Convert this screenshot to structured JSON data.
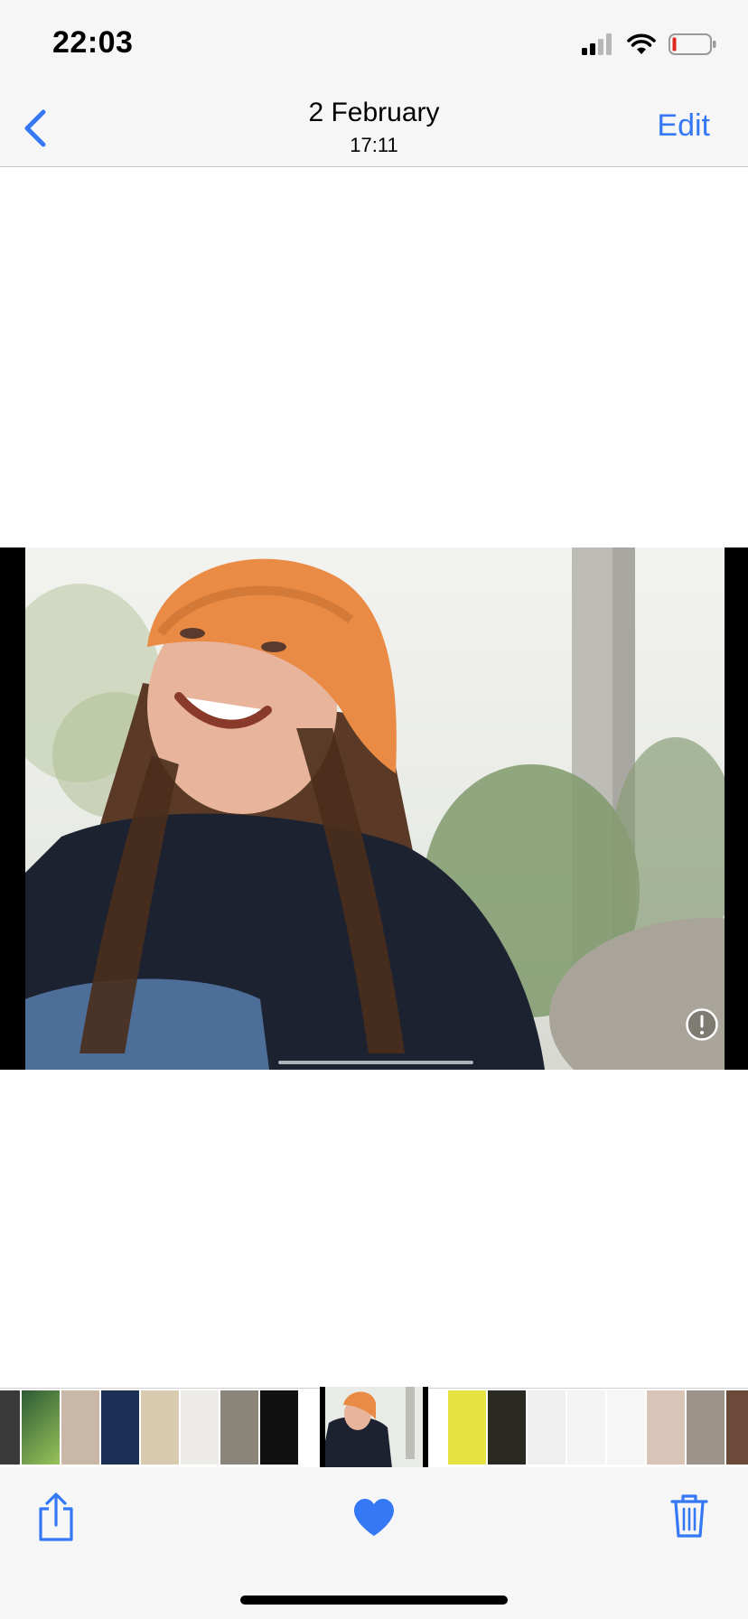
{
  "status_bar": {
    "time": "22:03",
    "icons": [
      "cellular-signal-icon",
      "wifi-icon",
      "battery-low-icon"
    ]
  },
  "nav": {
    "back_icon": "chevron-left-icon",
    "title": "2 February",
    "subtitle": "17:11",
    "edit_label": "Edit"
  },
  "photo": {
    "alt": "selfie-photo",
    "info_icon": "exclamation-circle-icon"
  },
  "toolbar": {
    "share_icon": "share-icon",
    "favorite_icon": "heart-filled-icon",
    "delete_icon": "trash-icon"
  },
  "colors": {
    "accent": "#3478f6",
    "bar_background": "#f6f6f6",
    "photo_letterbox": "#000000"
  }
}
